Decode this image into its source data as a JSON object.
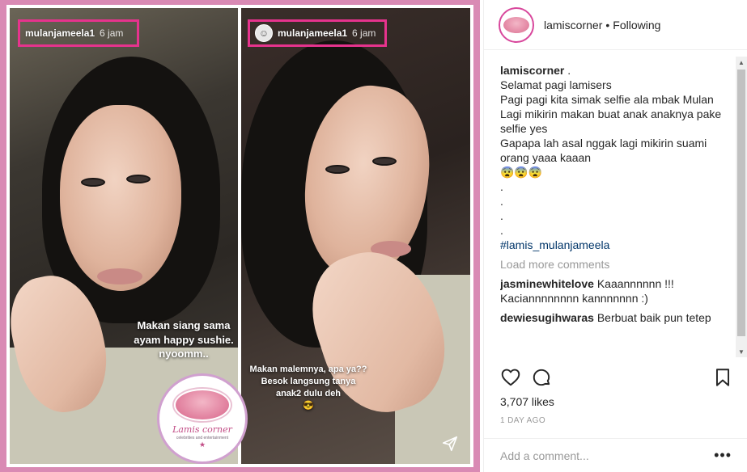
{
  "post": {
    "story_left": {
      "username": "mulanjameela1",
      "time": "6 jam",
      "caption": "Makan siang sama ayam happy sushie. nyoomm.."
    },
    "story_right": {
      "username": "mulanjameela1",
      "time": "6 jam",
      "caption": "Makan malemnya, apa ya?? Besok langsung tanya anak2 dulu deh",
      "emoji": "😎"
    },
    "logo": {
      "name": "Lamis corner",
      "tagline": "celebrities and entertainment",
      "star": "★"
    }
  },
  "header": {
    "username": "lamiscorner",
    "separator": "•",
    "follow_state": "Following"
  },
  "caption": {
    "username": "lamiscorner",
    "first": ".",
    "lines": [
      "Selamat pagi lamisers",
      "",
      "Pagi pagi kita simak selfie ala mbak Mulan",
      "",
      "Lagi mikirin makan buat anak anaknya pake selfie yes",
      "Gapapa lah asal nggak lagi mikirin suami orang yaaa kaaan",
      "😨😨😨",
      ".",
      ".",
      ".",
      "."
    ],
    "hashtag": "#lamis_mulanjameela"
  },
  "load_more": "Load more comments",
  "comments": [
    {
      "user": "jasminewhitelove",
      "text": "Kaaannnnnn !!! Kaciannnnnnnn kannnnnnn :)"
    },
    {
      "user": "dewiesugihwaras",
      "text": "Berbuat baik pun tetep"
    }
  ],
  "likes": "3,707 likes",
  "time_ago": "1 DAY AGO",
  "add_comment_placeholder": "Add a comment...",
  "more_label": "•••",
  "colors": {
    "frame": "#d98ab4",
    "highlight": "#e6338d",
    "hashtag": "#003569"
  },
  "icons": [
    "heart-icon",
    "comment-icon",
    "bookmark-icon",
    "send-icon",
    "more-icon"
  ]
}
